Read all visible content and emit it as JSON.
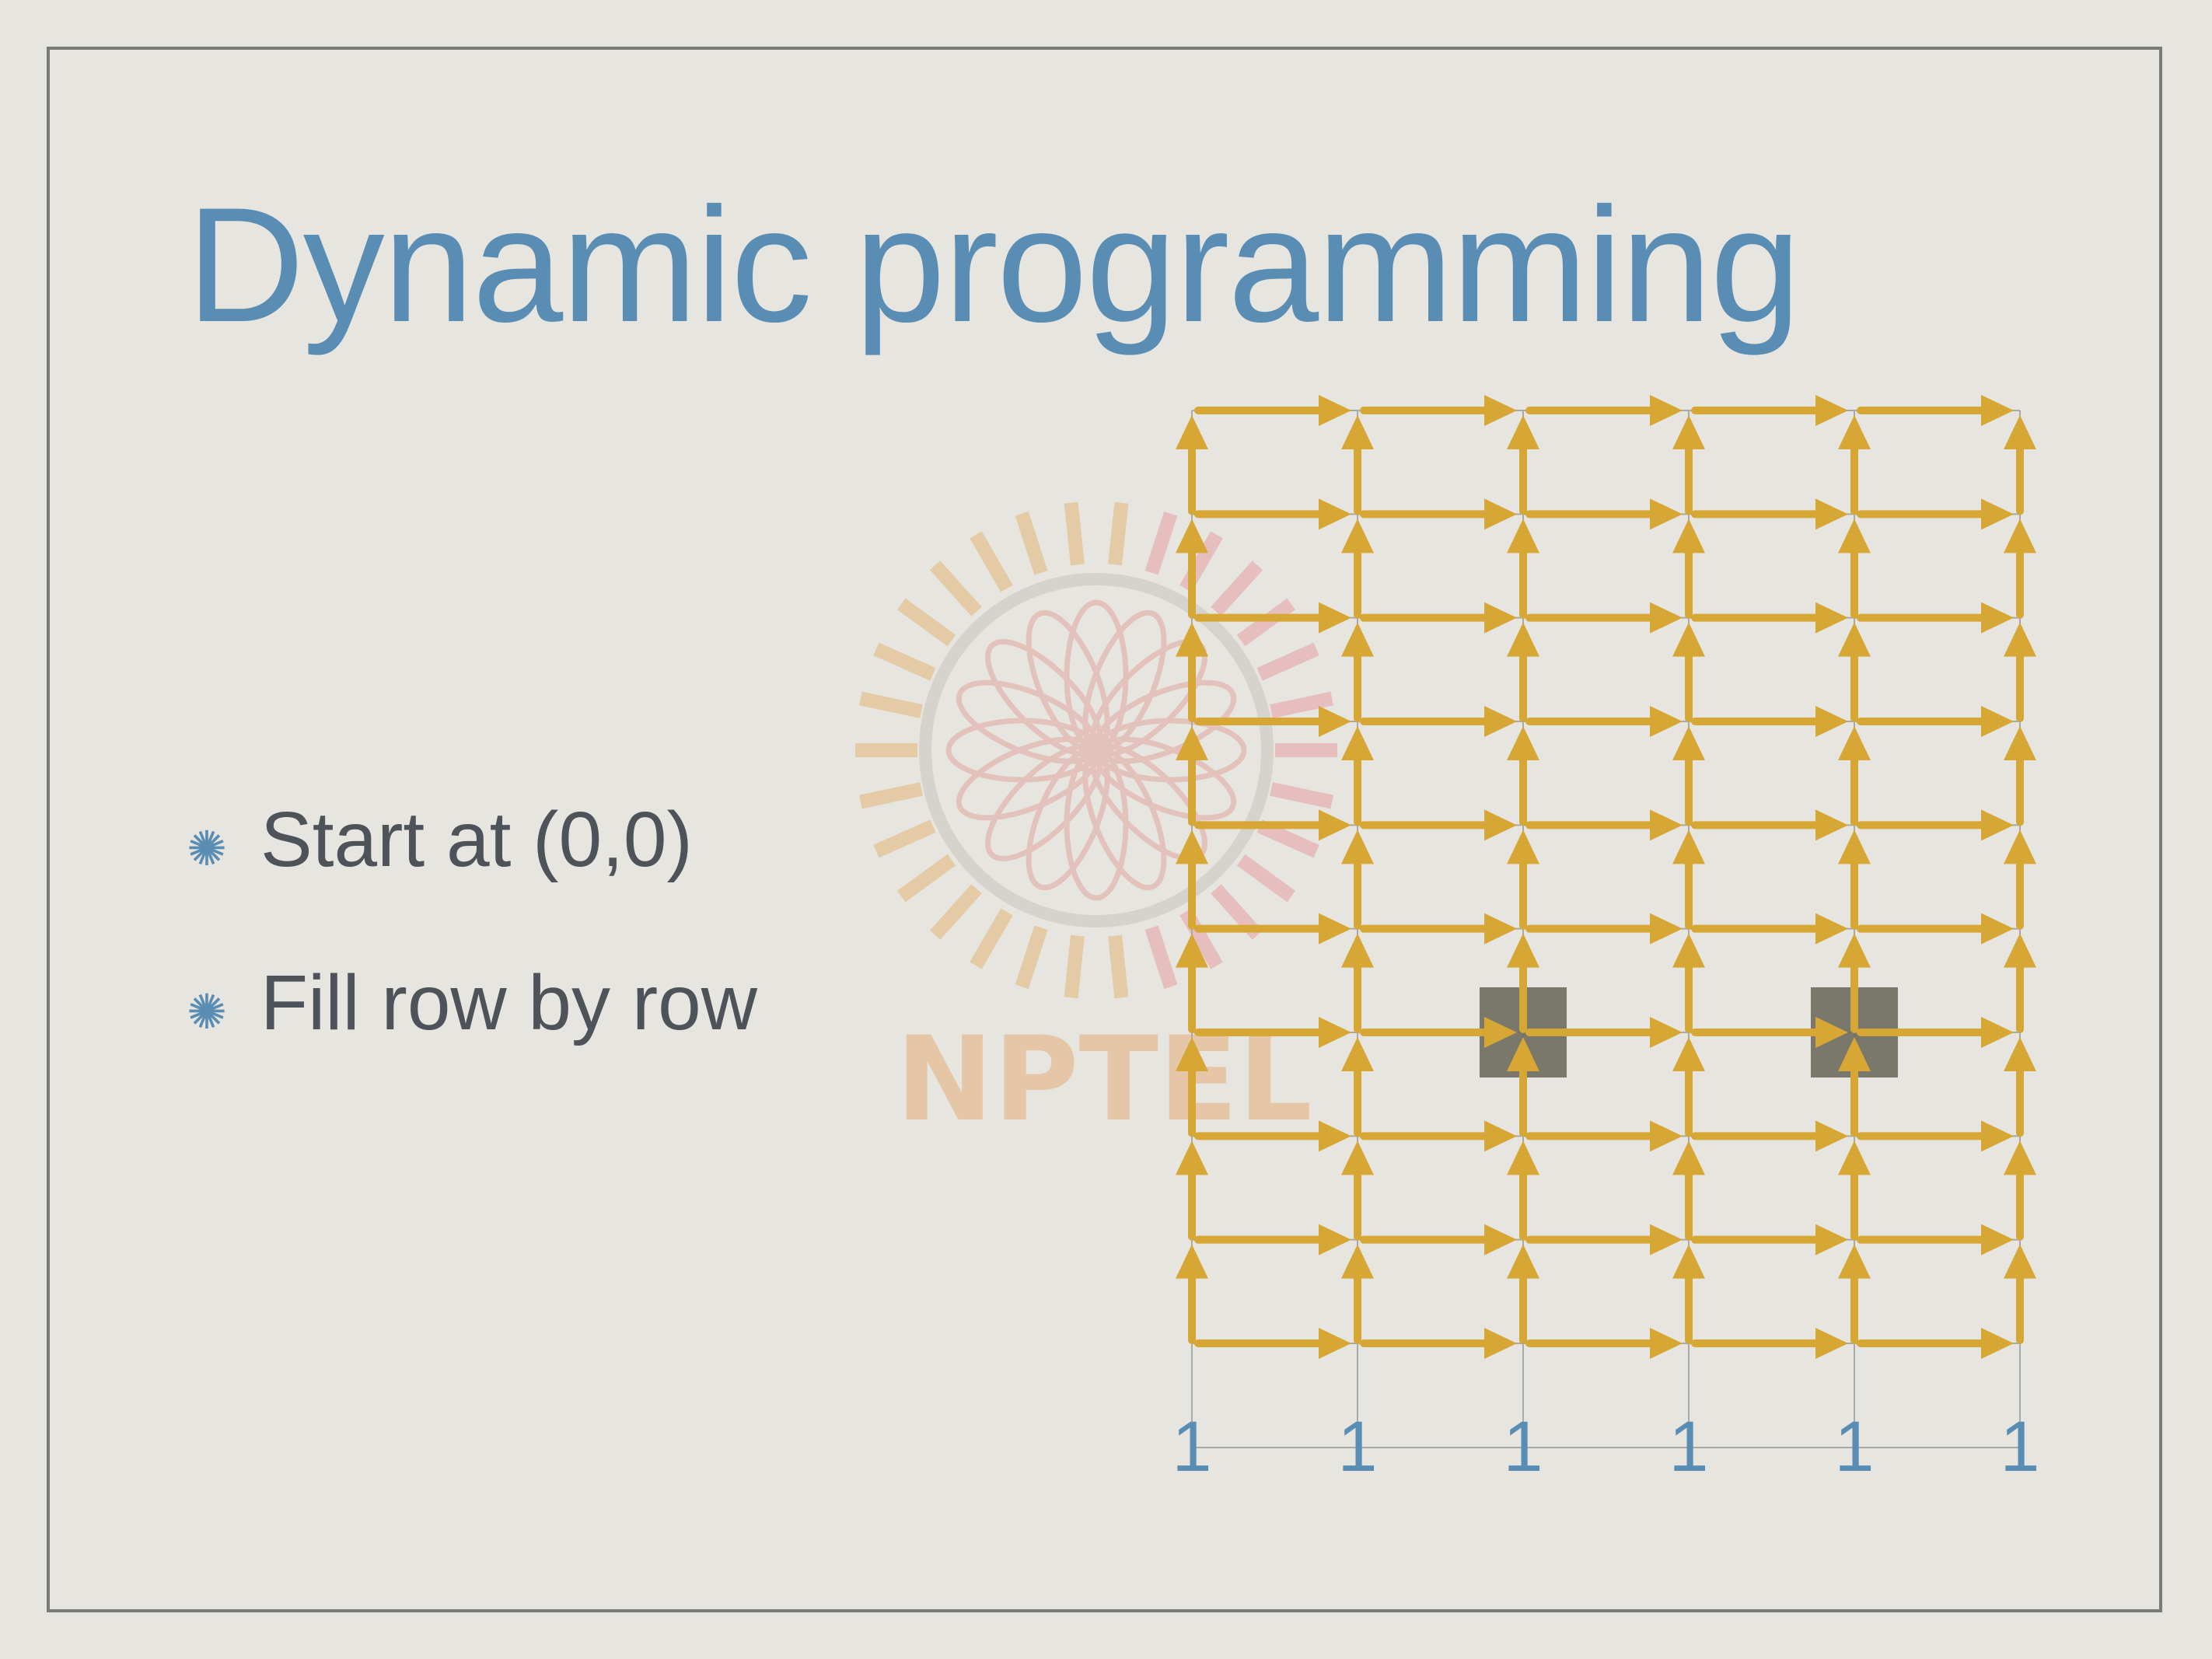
{
  "slide": {
    "title": "Dynamic programming",
    "bullets": [
      {
        "text": "Start at (0,0)",
        "icon": "asterisk-bullet-icon"
      },
      {
        "text": "Fill row by row",
        "icon": "asterisk-bullet-icon"
      }
    ]
  },
  "grid": {
    "columns": 6,
    "rows": 10,
    "blocked_nodes": [
      {
        "col": 2,
        "row": 3
      },
      {
        "col": 4,
        "row": 3
      }
    ],
    "bottom_row_values": [
      "1",
      "1",
      "1",
      "1",
      "1",
      "1"
    ],
    "colors": {
      "arrow": "#d6a734",
      "grid_line": "#a9a9a9",
      "blocked": "#6e6a5e",
      "value_text": "#5a8db3"
    }
  },
  "watermark": {
    "text": "NPTEL",
    "icon": "nptel-logo-watermark"
  }
}
